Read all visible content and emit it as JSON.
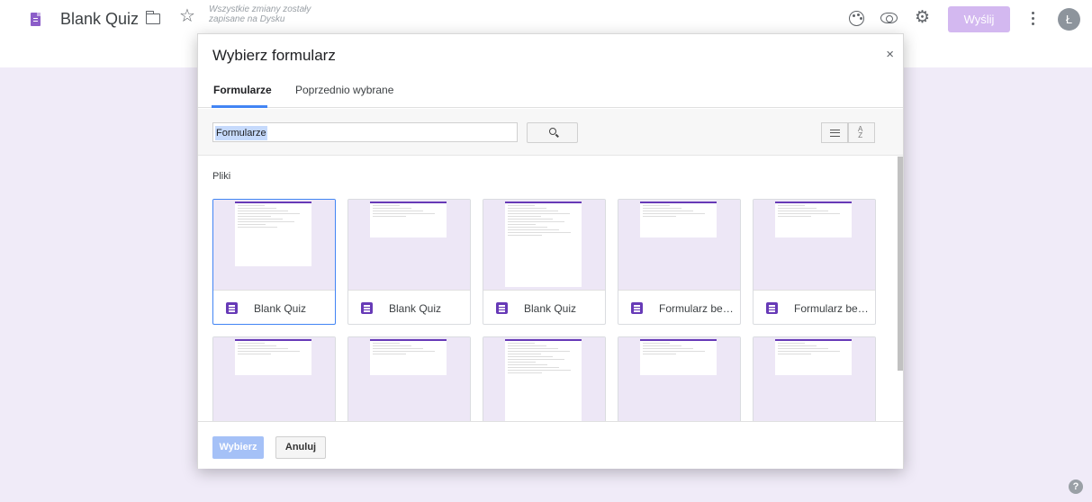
{
  "header": {
    "doc_title": "Blank Quiz",
    "save_status": "Wszystkie zmiany zostały zapisane na Dysku",
    "send_label": "Wyślij",
    "avatar_letter": "Ł",
    "accent_color": "#673ab7"
  },
  "dialog": {
    "title": "Wybierz formularz",
    "close_label": "×",
    "tabs": [
      {
        "label": "Formularze",
        "active": true
      },
      {
        "label": "Poprzednio wybrane",
        "active": false
      }
    ],
    "search": {
      "value": "Formularze"
    },
    "section_label": "Pliki",
    "files": [
      {
        "name": "Blank Quiz",
        "selected": true
      },
      {
        "name": "Blank Quiz",
        "selected": false
      },
      {
        "name": "Blank Quiz",
        "selected": false
      },
      {
        "name": "Formularz bez n...",
        "selected": false
      },
      {
        "name": "Formularz bez n...",
        "selected": false
      },
      {
        "name": "",
        "selected": false
      },
      {
        "name": "",
        "selected": false
      },
      {
        "name": "",
        "selected": false
      },
      {
        "name": "",
        "selected": false
      },
      {
        "name": "",
        "selected": false
      }
    ],
    "select_label": "Wybierz",
    "cancel_label": "Anuluj"
  },
  "help_label": "?"
}
